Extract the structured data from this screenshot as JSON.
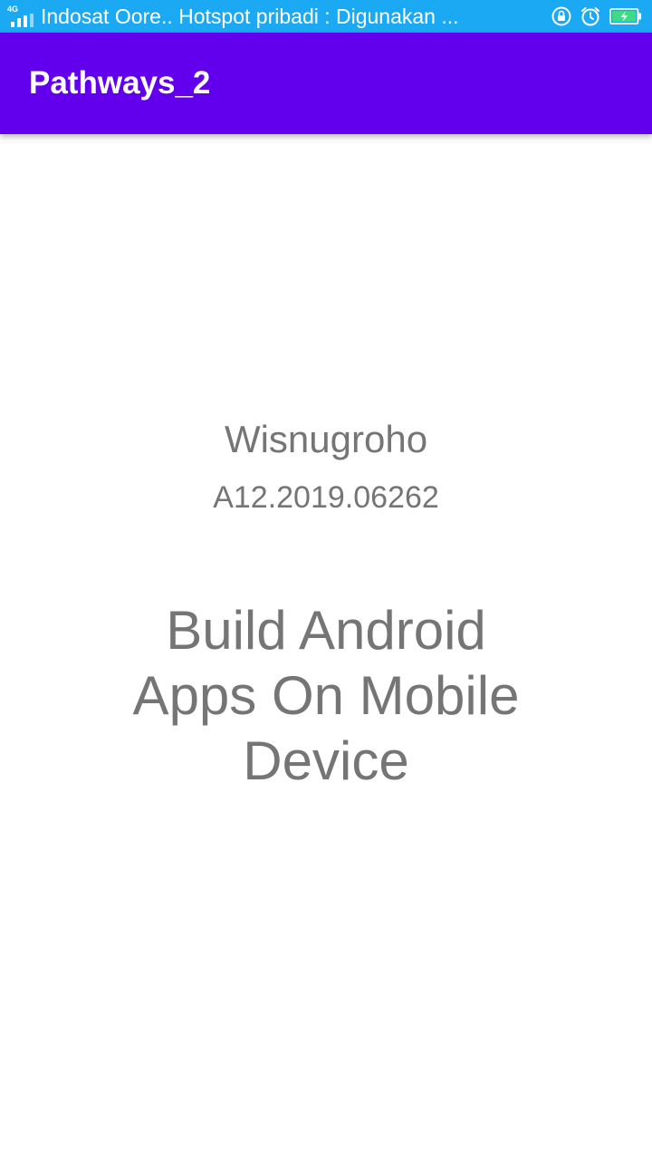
{
  "status_bar": {
    "network_type": "4G",
    "notification_text": "Indosat Oore.. Hotspot pribadi : Digunakan ...",
    "background_color": "#1aa9f2",
    "icons": [
      "signal-icon",
      "rotation-lock-icon",
      "alarm-icon",
      "battery-charging-icon"
    ]
  },
  "app_bar": {
    "title": "Pathways_2",
    "background_color": "#6200ee"
  },
  "main": {
    "name": "Wisnugroho",
    "student_id": "A12.2019.06262",
    "tagline": "Build Android Apps On Mobile Device",
    "text_color": "#757575"
  }
}
